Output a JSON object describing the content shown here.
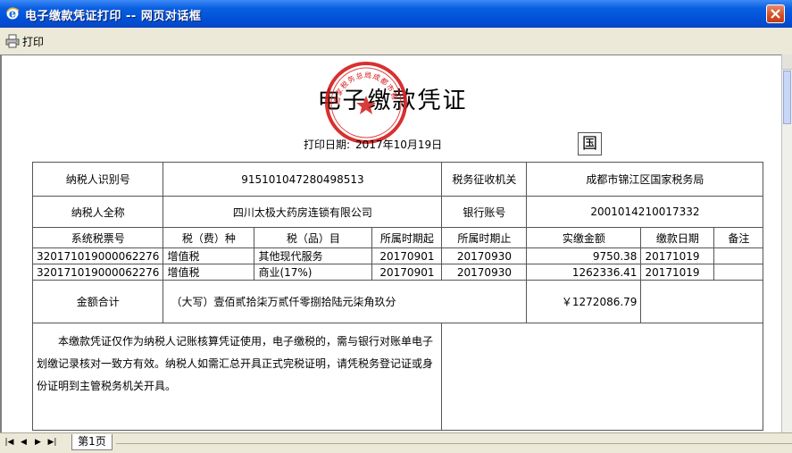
{
  "window": {
    "title": "电子缴款凭证打印 -- 网页对话框"
  },
  "toolbar": {
    "print_label": "打印"
  },
  "document": {
    "title": "电子缴款凭证",
    "print_date_label": "打印日期:",
    "print_date_value": "2017年10月19日",
    "guo_mark": "国",
    "seal_text": "国家税务总局成都市锦江区税务局",
    "taxpayer_id_label": "纳税人识别号",
    "taxpayer_id_value": "915101047280498513",
    "tax_office_label": "税务征收机关",
    "tax_office_value": "成都市锦江区国家税务局",
    "taxpayer_name_label": "纳税人全称",
    "taxpayer_name_value": "四川太极大药房连锁有限公司",
    "bank_account_label": "银行账号",
    "bank_account_value": "2001014210017332",
    "columns": [
      "系统税票号",
      "税（费）种",
      "税（品）目",
      "所属时期起",
      "所属时期止",
      "实缴金额",
      "缴款日期",
      "备注"
    ],
    "rows": [
      [
        "320171019000062276",
        "增值税",
        "其他现代服务",
        "20170901",
        "20170930",
        "9750.38",
        "20171019",
        ""
      ],
      [
        "320171019000062276",
        "增值税",
        "商业(17%)",
        "20170901",
        "20170930",
        "1262336.41",
        "20171019",
        ""
      ]
    ],
    "total_label": "金额合计",
    "total_words": "（大写）壹佰贰拾柒万贰仟零捌拾陆元柒角玖分",
    "total_amount": "￥1272086.79",
    "note_text": "本缴款凭证仅作为纳税人记账核算凭证使用，电子缴税的，需与银行对账单电子划缴记录核对一致方有效。纳税人如需汇总开具正式完税证明，请凭税务登记证或身份证明到主管税务机关开具。"
  },
  "status": {
    "page_tab": "第1页"
  },
  "colors": {
    "titlebar": "#0a5fe0",
    "seal_red": "#d41a1a",
    "chrome": "#ece9d8"
  }
}
